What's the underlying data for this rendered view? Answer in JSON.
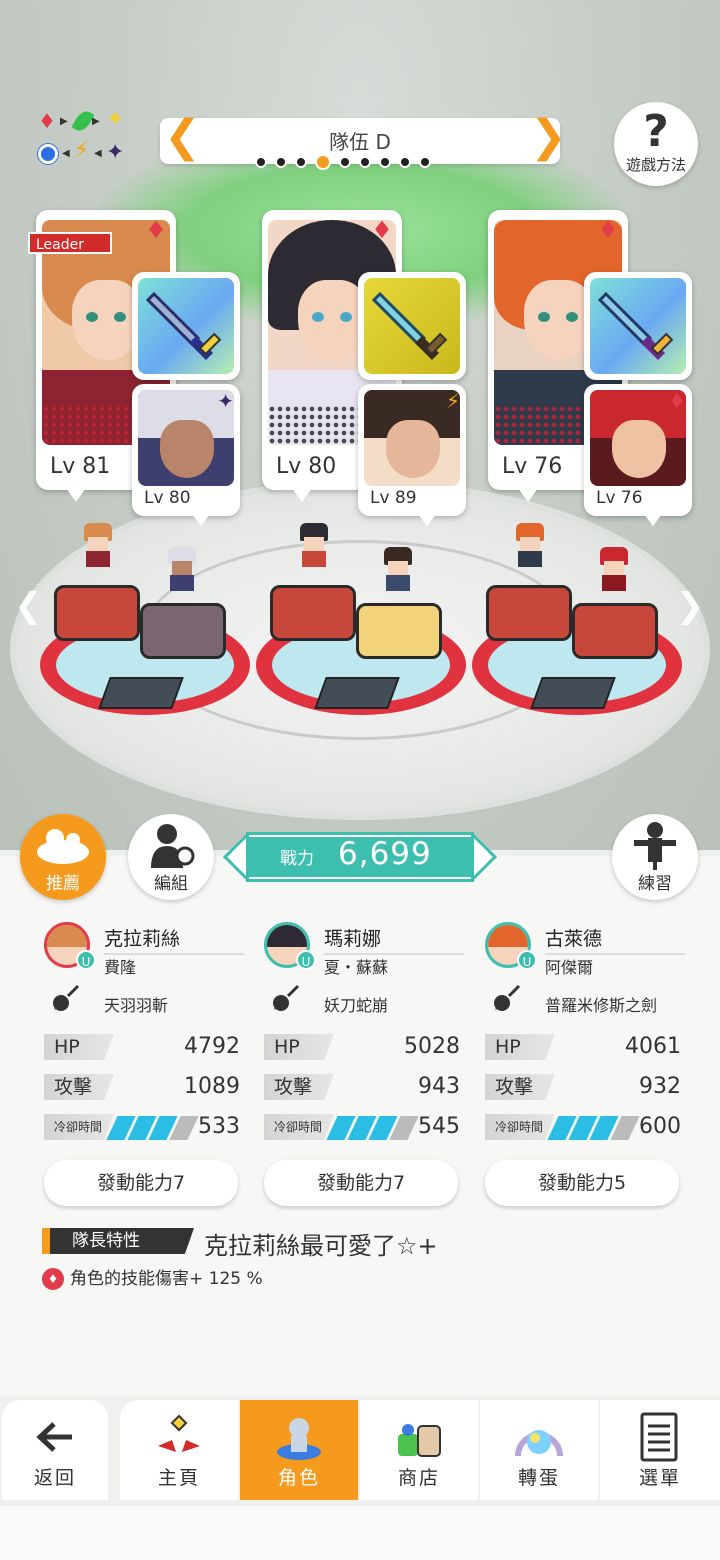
{
  "header": {
    "team_name": "隊伍 D",
    "team_dots_count": 9,
    "team_dots_active_index": 3,
    "help_label": "遊戲方法",
    "leader_tag": "Leader"
  },
  "slots": [
    {
      "main": {
        "level": "Lv 81",
        "element": "fire"
      },
      "support": {
        "level": "Lv 80",
        "element": "dark"
      }
    },
    {
      "main": {
        "level": "Lv 80",
        "element": "fire"
      },
      "support": {
        "level": "Lv 89",
        "element": "thunder"
      }
    },
    {
      "main": {
        "level": "Lv 76",
        "element": "fire"
      },
      "support": {
        "level": "Lv 76",
        "element": "fire"
      }
    }
  ],
  "actions": {
    "recommend": "推薦",
    "edit": "編組",
    "train": "練習"
  },
  "power": {
    "label": "戰力",
    "value": "6,699"
  },
  "members": [
    {
      "name": "克拉莉絲",
      "support": "費隆",
      "weapon": "天羽羽斬",
      "hp_label": "HP",
      "hp": "4792",
      "atk_label": "攻擊",
      "atk": "1089",
      "cd_label": "冷卻時間",
      "cd": "533",
      "cd_fill": 0.75,
      "ability": "發動能力7"
    },
    {
      "name": "瑪莉娜",
      "support": "夏・蘇蘇",
      "weapon": "妖刀蛇崩",
      "hp_label": "HP",
      "hp": "5028",
      "atk_label": "攻擊",
      "atk": "943",
      "cd_label": "冷卻時間",
      "cd": "545",
      "cd_fill": 0.75,
      "ability": "發動能力7"
    },
    {
      "name": "古萊德",
      "support": "阿傑爾",
      "weapon": "普羅米修斯之劍",
      "hp_label": "HP",
      "hp": "4061",
      "atk_label": "攻擊",
      "atk": "932",
      "cd_label": "冷卻時間",
      "cd": "600",
      "cd_fill": 0.75,
      "ability": "發動能力5"
    }
  ],
  "leader_skill": {
    "tag": "隊長特性",
    "title": "克拉莉絲最可愛了☆+",
    "effect": "角色的技能傷害+ 125 %"
  },
  "nav": {
    "back": "返回",
    "home": "主頁",
    "character": "角色",
    "shop": "商店",
    "gacha": "轉蛋",
    "menu": "選單"
  },
  "colors": {
    "accent": "#f59a1d",
    "teal": "#3dbfb0",
    "fire": "#e23b4a",
    "cooldown": "#2bbde3"
  }
}
